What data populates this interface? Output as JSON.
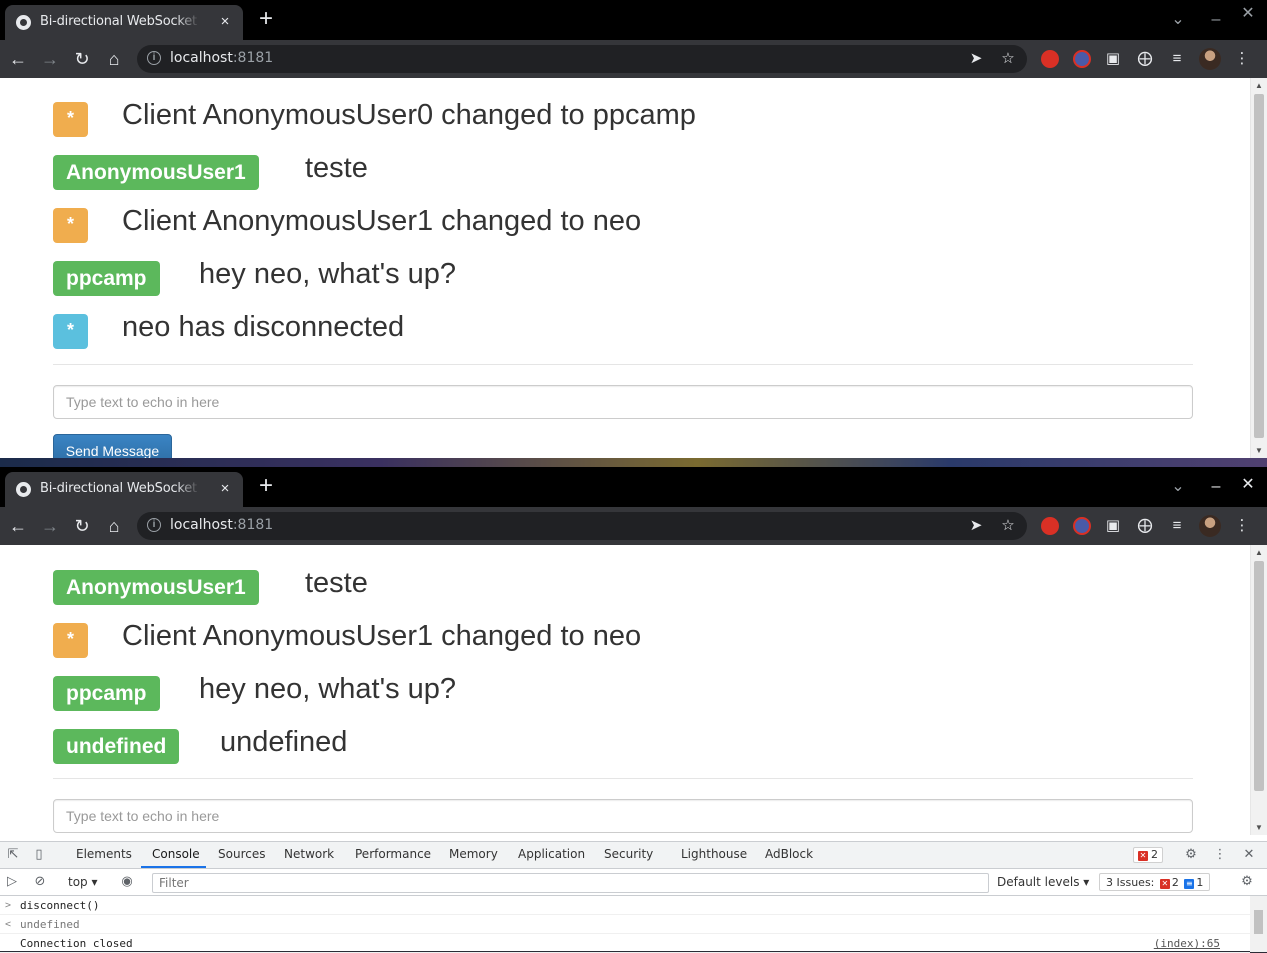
{
  "browser": {
    "tab_title": "Bi-directional WebSocket Chat",
    "tab_close": "×",
    "new_tab": "+",
    "url_host": "localhost",
    "url_port": ":8181"
  },
  "window_top": {
    "messages": [
      {
        "badge": "*",
        "badge_color": "#f0ad4e",
        "text": "Client AnonymousUser0 changed to ppcamp"
      },
      {
        "badge": "AnonymousUser1",
        "badge_color": "#5cb85c",
        "text": "teste"
      },
      {
        "badge": "*",
        "badge_color": "#f0ad4e",
        "text": "Client AnonymousUser1 changed to neo"
      },
      {
        "badge": "ppcamp",
        "badge_color": "#5cb85c",
        "text": "hey neo, what's up?"
      },
      {
        "badge": "*",
        "badge_color": "#5bc0de",
        "text": "neo has disconnected"
      }
    ],
    "input_placeholder": "Type text to echo in here",
    "send_label": "Send Message"
  },
  "window_bottom": {
    "messages": [
      {
        "badge": "AnonymousUser1",
        "badge_color": "#5cb85c",
        "text": "teste"
      },
      {
        "badge": "*",
        "badge_color": "#f0ad4e",
        "text": "Client AnonymousUser1 changed to neo"
      },
      {
        "badge": "ppcamp",
        "badge_color": "#5cb85c",
        "text": "hey neo, what's up?"
      },
      {
        "badge": "undefined",
        "badge_color": "#5cb85c",
        "text": "undefined"
      }
    ],
    "input_placeholder": "Type text to echo in here"
  },
  "devtools": {
    "tabs": [
      "Elements",
      "Console",
      "Sources",
      "Network",
      "Performance",
      "Memory",
      "Application",
      "Security",
      "Lighthouse",
      "AdBlock"
    ],
    "active_tab": "Console",
    "error_count": "2",
    "context": "top",
    "filter_placeholder": "Filter",
    "levels": "Default levels",
    "issues_label": "3 Issues:",
    "issues_errors": "2",
    "issues_info": "1",
    "console": [
      {
        "prompt": ">",
        "text": "disconnect()",
        "kind": "input"
      },
      {
        "prompt": "<",
        "text": "undefined",
        "kind": "result"
      },
      {
        "prompt": "",
        "text": "Connection closed",
        "kind": "log",
        "source": "(index):65"
      }
    ]
  }
}
